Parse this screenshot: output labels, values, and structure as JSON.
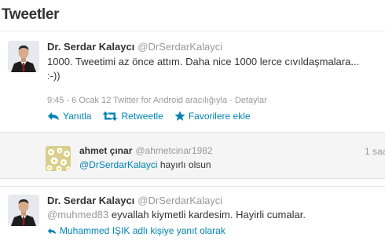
{
  "page": {
    "title": "Tweetler"
  },
  "tweets": [
    {
      "name": "Dr. Serdar Kalaycı",
      "screen_name": "@DrSerdarKalayci",
      "text_line1": "1000. Tweetimi az önce attım. Daha nice 1000 lerce cıvıldaşmalara...",
      "text_line2": ":-))",
      "meta": "9:45 - 6 Ocak 12 Twitter for Android aracılığıyla · Detaylar",
      "actions": {
        "reply": "Yanıtla",
        "retweet": "Retweetle",
        "favorite": "Favorilere ekle"
      }
    },
    {
      "name": "Dr. Serdar Kalaycı",
      "screen_name": "@DrSerdarKalayci",
      "mention": "@muhmed83",
      "text": " eyvallah kiymetli kardesim. Hayirli cumalar.",
      "in_reply_to": "Muhammed IŞIK adlı kişiye yanıt olarak"
    }
  ],
  "reply": {
    "name": "ahmet çınar",
    "screen_name": "@ahmetcinar1982",
    "mention": "@DrSerdarKalayci",
    "text": " hayırlı olsun",
    "time": "1 saa"
  },
  "colors": {
    "link": "#0084b4",
    "muted": "#999999",
    "text": "#333333",
    "reply_bg": "#f5f5f5"
  },
  "icons": {
    "reply": "reply-arrow-icon",
    "retweet": "retweet-icon",
    "favorite": "star-icon"
  }
}
